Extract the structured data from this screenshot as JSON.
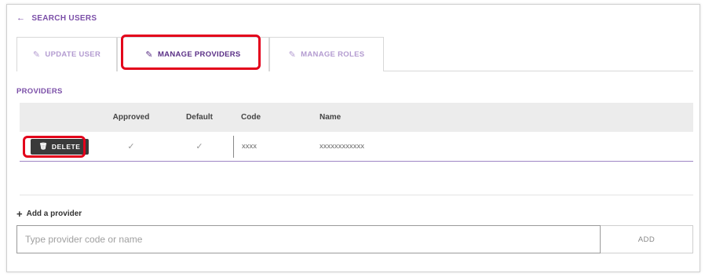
{
  "back_link": {
    "label": "SEARCH USERS"
  },
  "tabs": [
    {
      "label": "UPDATE USER"
    },
    {
      "label": "MANAGE PROVIDERS"
    },
    {
      "label": "MANAGE ROLES"
    }
  ],
  "active_tab": "MANAGE PROVIDERS",
  "providers": {
    "title": "PROVIDERS",
    "columns": [
      "",
      "Approved",
      "Default",
      "Code",
      "Name"
    ],
    "rows": [
      {
        "action_label": "DELETE",
        "approved": "✓",
        "default": "✓",
        "code": "xxxx",
        "name": "xxxxxxxxxxxx"
      }
    ]
  },
  "add_provider": {
    "label": "Add a provider",
    "placeholder": "Type provider code or name",
    "value": "",
    "button_label": "ADD"
  },
  "colors": {
    "accent": "#7b4fa8",
    "highlight": "#e3001b",
    "delete_button": "#3a3a3a"
  }
}
